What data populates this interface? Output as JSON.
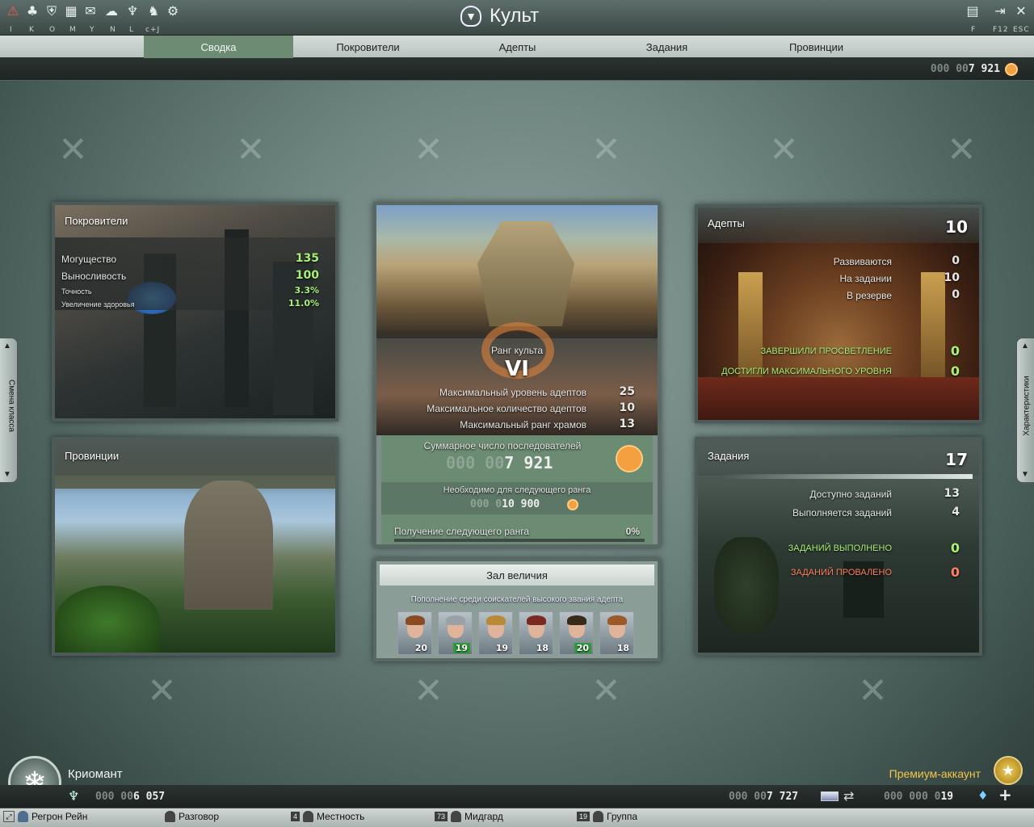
{
  "window": {
    "title": "Культ"
  },
  "toolbar": {
    "keys": [
      "I",
      "K",
      "O",
      "M",
      "Y",
      "N",
      "L",
      "c+J"
    ],
    "right_keys": [
      "F",
      "F12",
      "ESC"
    ],
    "icons": [
      "alert-icon",
      "guild-icon",
      "map-icon",
      "chat-icon",
      "mount-icon",
      "cult-icon",
      "pet-icon",
      "settings-icon"
    ]
  },
  "tabs": [
    "Сводка",
    "Покровители",
    "Адепты",
    "Задания",
    "Провинции"
  ],
  "active_tab": "Сводка",
  "currency": {
    "dim": "000 00",
    "value": "7 921"
  },
  "patrons": {
    "title": "Покровители",
    "stats": [
      {
        "label": "Могущество",
        "value": "135"
      },
      {
        "label": "Выносливость",
        "value": "100"
      },
      {
        "label": "Точность",
        "value": "3.3%"
      },
      {
        "label": "Увеличение здоровья",
        "value": "11.0%"
      }
    ]
  },
  "provinces": {
    "title": "Провинции"
  },
  "cult": {
    "rank_label": "Ранг культа",
    "rank": "VI",
    "rows": [
      {
        "label": "Максимальный уровень адептов",
        "value": "25"
      },
      {
        "label": "Максимальное количество адептов",
        "value": "10"
      },
      {
        "label": "Максимальный ранг храмов",
        "value": "13"
      }
    ],
    "followers_label": "Суммарное число последователей",
    "followers_dim": "000 00",
    "followers": "7 921",
    "next_label": "Необходимо для следующего ранга",
    "next_dim": "000 0",
    "next": "10 900",
    "progress_label": "Получение следующего ранга",
    "progress": "0%",
    "progress_value": 0
  },
  "hall": {
    "title": "Зал величия",
    "subtitle": "Пополнение среди соискателей высокого звания адепта",
    "adepts": [
      {
        "level": "20",
        "highlight": false,
        "hair": "#8a4a22"
      },
      {
        "level": "19",
        "highlight": true,
        "hair": "#9aa0a8"
      },
      {
        "level": "19",
        "highlight": false,
        "hair": "#b88a3a"
      },
      {
        "level": "18",
        "highlight": false,
        "hair": "#7a2a22"
      },
      {
        "level": "20",
        "highlight": true,
        "hair": "#3a2a1a"
      },
      {
        "level": "18",
        "highlight": false,
        "hair": "#9a5a2a"
      }
    ]
  },
  "adepts": {
    "title": "Адепты",
    "count": "10",
    "rows": [
      {
        "label": "Развиваются",
        "value": "0"
      },
      {
        "label": "На задании",
        "value": "10"
      },
      {
        "label": "В резерве",
        "value": "0"
      }
    ],
    "green_rows": [
      {
        "label": "Завершили просветление",
        "value": "0"
      },
      {
        "label": "Достигли максимального уровня",
        "value": "0"
      }
    ]
  },
  "missions": {
    "title": "Задания",
    "count": "17",
    "rows": [
      {
        "label": "Доступно заданий",
        "value": "13"
      },
      {
        "label": "Выполняется заданий",
        "value": "4"
      }
    ],
    "done": {
      "label": "Заданий выполнено",
      "value": "0"
    },
    "failed": {
      "label": "Заданий провалено",
      "value": "0"
    }
  },
  "side": {
    "left": "Смена класса",
    "right": "Характеристики"
  },
  "player": {
    "class": "Криомант",
    "premium": "Премиум-аккаунт",
    "money_dim": "000 00",
    "money": "6 057",
    "gold_dim": "000 00",
    "gold": "7 727",
    "crystal_dim": "000 000 0",
    "crystal": "19"
  },
  "chat": [
    {
      "name": "Регрон Рейн",
      "badge": ""
    },
    {
      "name": "Разговор",
      "badge": ""
    },
    {
      "name": "Местность",
      "badge": "4"
    },
    {
      "name": "Мидгард",
      "badge": "73"
    },
    {
      "name": "Группа",
      "badge": "19"
    }
  ]
}
